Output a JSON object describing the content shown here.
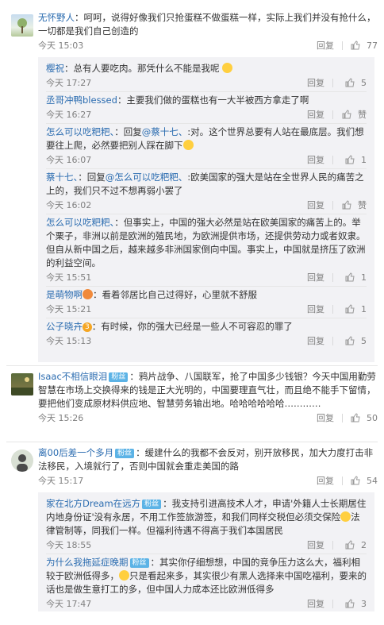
{
  "comments": [
    {
      "name": "无怀野人",
      "text": "：呵呵，说得好像我们只抢蛋糕不做蛋糕一样，实际上我们并没有抢什么，一切都是我们自己创造的",
      "time": "今天 15:03",
      "reply": "回复",
      "likes": "77"
    },
    {
      "name": "Isaac不相信眼泪",
      "badge": "粉丝",
      "text": "：鸦片战争、八国联军，抢了中国多少钱银？今天中国用勤劳智慧在市场上交换得来的钱是正大光明的，中国要理直气壮，而且绝不能手下留情，要把他们变成原材料供应地、智慧劳务输出地。哈哈哈哈哈哈…………",
      "time": "今天 15:26",
      "reply": "回复",
      "likes": "50"
    },
    {
      "name": "离00后差一个多月",
      "badge": "粉丝",
      "text": "：缓建什么的我都不会反对，别开放移民，加大力度打击非法移民，入境就行了，否则中国就会重走美国的路",
      "time": "今天 15:17",
      "reply": "回复",
      "likes": "54"
    }
  ],
  "replies_a": [
    {
      "name": "樱祝",
      "text": "：总有人要吃肉。那凭什么不能是我呢",
      "time": "今天 17:27",
      "reply": "回复",
      "likes": "5"
    },
    {
      "name": "丞哥冲鸭blessed",
      "text": "：主要我们做的蛋糕也有一大半被西方拿走了啊",
      "time": "今天 16:27",
      "reply": "回复",
      "likes": "赞"
    },
    {
      "name": "怎么可以吃粑粑、",
      "mention": "@蔡十七、",
      "pre": "：回复",
      "text": ":对。这个世界总要有人站在最底层。我们想要往上爬，必然要把别人踩在脚下",
      "time": "今天 16:07",
      "reply": "回复",
      "likes": "1"
    },
    {
      "name": "蔡十七、",
      "mention": "@怎么可以吃粑粑、",
      "pre": "：回复",
      "text": ":欧美国家的强大是站在全世界人民的痛苦之上的，我们只不过不想再弱小罢了",
      "time": "今天 16:02",
      "reply": "回复",
      "likes": "赞"
    },
    {
      "name": "怎么可以吃粑粑、",
      "text": "：但事实上，中国的强大必然是站在欧美国家的痛苦上的。举个栗子，非洲以前是欧洲的殖民地，为欧洲提供市场，还提供劳动力或者奴隶。但自从新中国之后，越来越多非洲国家倒向中国。事实上，中国就是挤压了欧洲的利益空间。",
      "time": "今天 15:51",
      "reply": "回复",
      "likes": "1"
    },
    {
      "name": "是萌物啊",
      "text": "：看着邻居比自己过得好，心里就不舒服",
      "time": "今天 15:21",
      "reply": "回复",
      "likes": "1"
    },
    {
      "name": "公子晓卉",
      "ubadge": "3",
      "text": "：有时候，你的强大已经是一些人不可容忍的罪了",
      "time": "今天 15:13",
      "reply": "回复",
      "likes": "5"
    }
  ],
  "replies_c": [
    {
      "name": "家在北方Dream在远方",
      "badge": "粉丝",
      "text": "：我支持引进高技术人才，申请'外籍人士长期居住内地身份证'没有永居，不用工作签旅游签，和我们同样交税但必须交保险",
      "text2": "法律管制等，同我们一样。但福利待遇不得高于我们本国居民",
      "time": "今天 18:55",
      "reply": "回复",
      "likes": "2"
    },
    {
      "name": "为什么我拖延症晚期",
      "badge": "粉丝",
      "text": "：其实你仔细想想，中国的竞争压力这么大，福利相较于欧洲低得多，",
      "text2": "只是看起来多，其实很少有黑人选择来中国吃福利，要来的话也是做生意打工的多，但中国人力成本还比欧洲低得多",
      "time": "今天 17:47",
      "reply": "回复",
      "likes": "3"
    }
  ],
  "colors": {
    "name": "#eb7350",
    "link": "#2b6cb0",
    "bg_reply": "#f2f2f5"
  }
}
